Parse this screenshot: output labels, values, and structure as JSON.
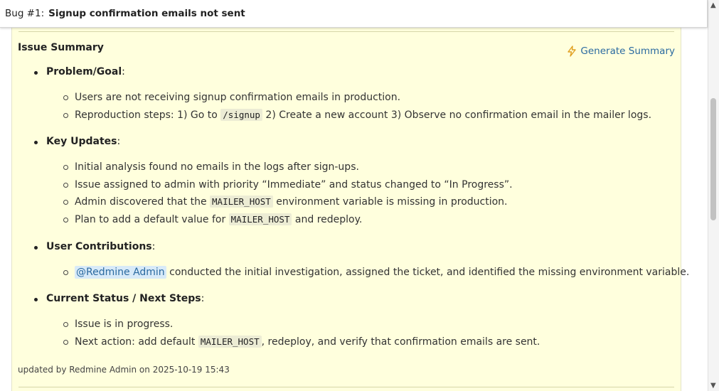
{
  "header": {
    "bug_number": "Bug #1:",
    "subject": "Signup confirmation emails not sent"
  },
  "summary": {
    "title": "Issue Summary",
    "generate_label": "Generate Summary",
    "sections": [
      {
        "heading": "Problem/Goal",
        "items": [
          {
            "parts": [
              {
                "t": "Users are not receiving signup confirmation emails in production."
              }
            ]
          },
          {
            "parts": [
              {
                "t": "Reproduction steps: 1) Go to "
              },
              {
                "code": "/signup"
              },
              {
                "t": " 2) Create a new account 3) Observe no confirmation email in the mailer logs."
              }
            ]
          }
        ]
      },
      {
        "heading": "Key Updates",
        "items": [
          {
            "parts": [
              {
                "t": "Initial analysis found no emails in the logs after sign-ups."
              }
            ]
          },
          {
            "parts": [
              {
                "t": "Issue assigned to admin with priority “Immediate” and status changed to “In Progress”."
              }
            ]
          },
          {
            "parts": [
              {
                "t": "Admin discovered that the "
              },
              {
                "code": "MAILER_HOST"
              },
              {
                "t": " environment variable is missing in production."
              }
            ]
          },
          {
            "parts": [
              {
                "t": "Plan to add a default value for "
              },
              {
                "code": "MAILER_HOST"
              },
              {
                "t": " and redeploy."
              }
            ]
          }
        ]
      },
      {
        "heading": "User Contributions",
        "items": [
          {
            "parts": [
              {
                "mention": "@Redmine Admin"
              },
              {
                "t": " conducted the initial investigation, assigned the ticket, and identified the missing environment variable."
              }
            ]
          }
        ]
      },
      {
        "heading": "Current Status / Next Steps",
        "items": [
          {
            "parts": [
              {
                "t": "Issue is in progress."
              }
            ]
          },
          {
            "parts": [
              {
                "t": "Next action: add default "
              },
              {
                "code": "MAILER_HOST"
              },
              {
                "t": ", redeploy, and verify that confirmation emails are sent."
              }
            ]
          }
        ]
      }
    ],
    "footer": "updated by Redmine Admin on 2025-10-19 15:43"
  },
  "colors": {
    "box_bg": "#ffffdd",
    "link": "#2a6aa0",
    "icon": "#e0a020"
  },
  "icons": {
    "generate": "lightning-icon"
  }
}
